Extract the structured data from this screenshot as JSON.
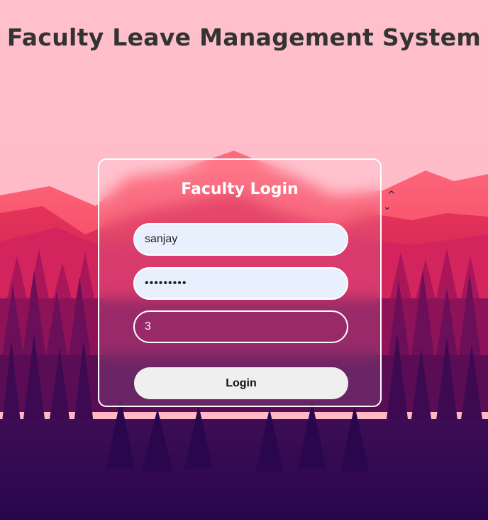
{
  "page": {
    "title": "Faculty Leave Management System"
  },
  "login_card": {
    "heading": "Faculty Login",
    "username": {
      "value": "sanjay"
    },
    "password": {
      "value": "sanjay123"
    },
    "captcha": {
      "value": "3"
    },
    "login_label": "Login"
  },
  "colors": {
    "sky": "#ffc0cb",
    "title_text": "#333333",
    "input_filled_bg": "#e8f0fe",
    "button_bg": "#efefef",
    "forest_dark": "#2a0a4f"
  },
  "icons": {
    "bird": "bird-icon"
  }
}
